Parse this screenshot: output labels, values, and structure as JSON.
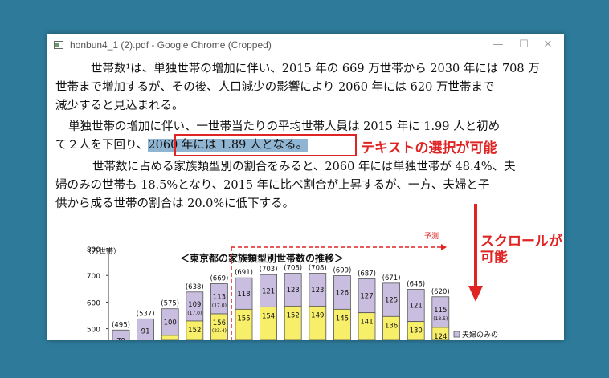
{
  "window": {
    "title": "honbun4_1 (2).pdf - Google Chrome (Cropped)",
    "minimize": "—",
    "maximize": "☐",
    "close": "✕"
  },
  "document": {
    "p1_l1": "世帯数¹は、単独世帯の増加に伴い、2015 年の 669 万世帯から 2030 年には 708 万",
    "p1_l2": "世帯まで増加するが、その後、人口減少の影響により 2060 年には 620 万世帯まで",
    "p1_l3": "減少すると見込まれる。",
    "p2_l1": "単独世帯の増加に伴い、一世帯当たりの平均世帯人員は 2015 年に 1.99 人と初め",
    "p2_l2a": "て２人を下回り、",
    "p2_l2_selected": "2060 年には 1.89 人となる。",
    "p3_l1": "世帯数に占める家族類型別の割合をみると、2060 年には単独世帯が 48.4%、夫",
    "p3_l2": "婦のみの世帯も 18.5%となり、2015 年に比べ割合が上昇するが、一方、夫婦と子",
    "p3_l3": "供から成る世帯の割合は 20.0%に低下する。"
  },
  "annotations": {
    "text_selectable": "テキストの選択が可能",
    "scrollable_l1": "スクロールが",
    "scrollable_l2": "可能"
  },
  "colors": {
    "accent_red": "#e02424",
    "selection": "#8fb5d3",
    "couple_only": "#c9bedf",
    "single": "#f7ef6a",
    "background": "#2d7a9a"
  },
  "chart_data": {
    "type": "bar",
    "title": "＜東京都の家族類型別世帯数の推移＞",
    "ylabel": "（万世帯）",
    "ylim": [
      400,
      800
    ],
    "yticks": [
      "800",
      "700",
      "600",
      "500"
    ],
    "forecast_label": "予測",
    "totals": [
      "(495)",
      "(537)",
      "(575)",
      "(638)",
      "(669)",
      "(691)",
      "(703)",
      "(708)",
      "(708)",
      "(699)",
      "(687)",
      "(671)",
      "(648)",
      "(620)"
    ],
    "total_values": [
      495,
      537,
      575,
      638,
      669,
      691,
      703,
      708,
      708,
      699,
      687,
      671,
      648,
      620
    ],
    "series": [
      {
        "name": "夫婦のみの",
        "values": [
          "79",
          "91",
          "100",
          "109",
          "113",
          "118",
          "121",
          "123",
          "123",
          "126",
          "127",
          "125",
          "121",
          "115"
        ],
        "values_num": [
          79,
          91,
          100,
          109,
          113,
          118,
          121,
          123,
          123,
          126,
          127,
          125,
          121,
          115
        ]
      },
      {
        "values": [
          "",
          "",
          "",
          "152",
          "156",
          "155",
          "154",
          "152",
          "149",
          "145",
          "141",
          "136",
          "130",
          "124"
        ],
        "values_num": [
          null,
          null,
          null,
          152,
          156,
          155,
          154,
          152,
          149,
          145,
          141,
          136,
          130,
          124
        ]
      }
    ],
    "share_labels": [
      "",
      "",
      "",
      "(17.0)",
      "(17.0)",
      "",
      "",
      "",
      "",
      "",
      "",
      "",
      "",
      "(18.5)"
    ],
    "lower_share_labels": [
      "",
      "",
      "",
      "",
      "(23.4)",
      "",
      "",
      "",
      "",
      "",
      "",
      "",
      "",
      ""
    ]
  }
}
